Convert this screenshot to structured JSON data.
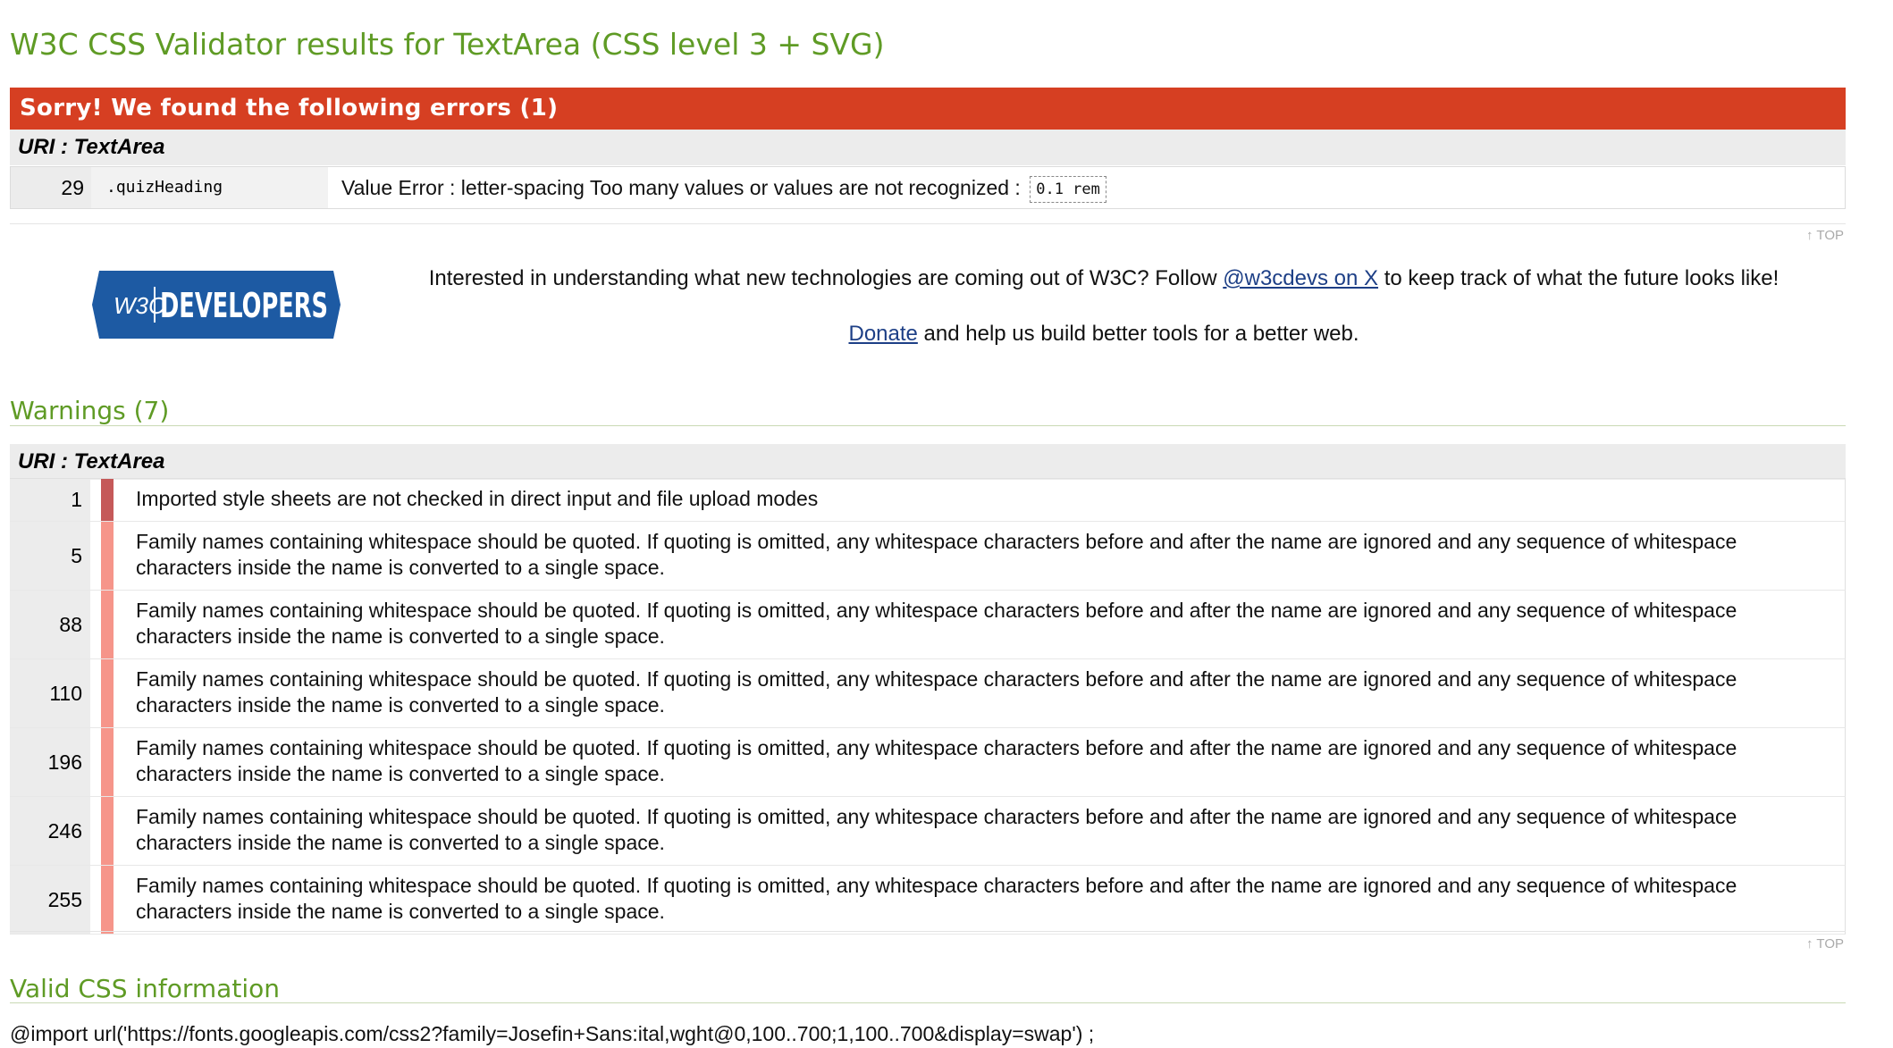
{
  "page_title": "W3C CSS Validator results for TextArea (CSS level 3 + SVG)",
  "errors": {
    "banner": "Sorry! We found the following errors (1)",
    "uri_label": "URI : TextArea",
    "rows": [
      {
        "line": "29",
        "context": ".quizHeading",
        "message": "Value Error : letter-spacing Too many values or values are not recognized : ",
        "value": "0.1 rem"
      }
    ],
    "top_link": "↑ TOP"
  },
  "promo": {
    "logo_w3c": "W3C",
    "logo_text": "DEVELOPERS",
    "line1_before": "Interested in understanding what new technologies are coming out of W3C? Follow ",
    "line1_link": "@w3cdevs on X",
    "line1_after": " to keep track of what the future looks like!",
    "line2_link": "Donate",
    "line2_after": " and help us build better tools for a better web.",
    "brand_color": "#1d5aa3"
  },
  "warnings": {
    "heading": "Warnings (7)",
    "uri_label": "URI : TextArea",
    "rows": [
      {
        "line": "1",
        "message": "Imported style sheets are not checked in direct input and file upload modes"
      },
      {
        "line": "5",
        "message": "Family names containing whitespace should be quoted. If quoting is omitted, any whitespace characters before and after the name are ignored and any sequence of whitespace characters inside the name is converted to a single space."
      },
      {
        "line": "88",
        "message": "Family names containing whitespace should be quoted. If quoting is omitted, any whitespace characters before and after the name are ignored and any sequence of whitespace characters inside the name is converted to a single space."
      },
      {
        "line": "110",
        "message": "Family names containing whitespace should be quoted. If quoting is omitted, any whitespace characters before and after the name are ignored and any sequence of whitespace characters inside the name is converted to a single space."
      },
      {
        "line": "196",
        "message": "Family names containing whitespace should be quoted. If quoting is omitted, any whitespace characters before and after the name are ignored and any sequence of whitespace characters inside the name is converted to a single space."
      },
      {
        "line": "246",
        "message": "Family names containing whitespace should be quoted. If quoting is omitted, any whitespace characters before and after the name are ignored and any sequence of whitespace characters inside the name is converted to a single space."
      },
      {
        "line": "255",
        "message": "Family names containing whitespace should be quoted. If quoting is omitted, any whitespace characters before and after the name are ignored and any sequence of whitespace characters inside the name is converted to a single space."
      }
    ],
    "top_link": "↑ TOP"
  },
  "valid": {
    "heading": "Valid CSS information",
    "first_line": "@import url('https://fonts.googleapis.com/css2?family=Josefin+Sans:ital,wght@0,100..700;1,100..700&display=swap') ;"
  },
  "colors": {
    "heading_green": "#5f9b25",
    "error_red": "#d63f22",
    "warning_bar": "#f6958a"
  }
}
